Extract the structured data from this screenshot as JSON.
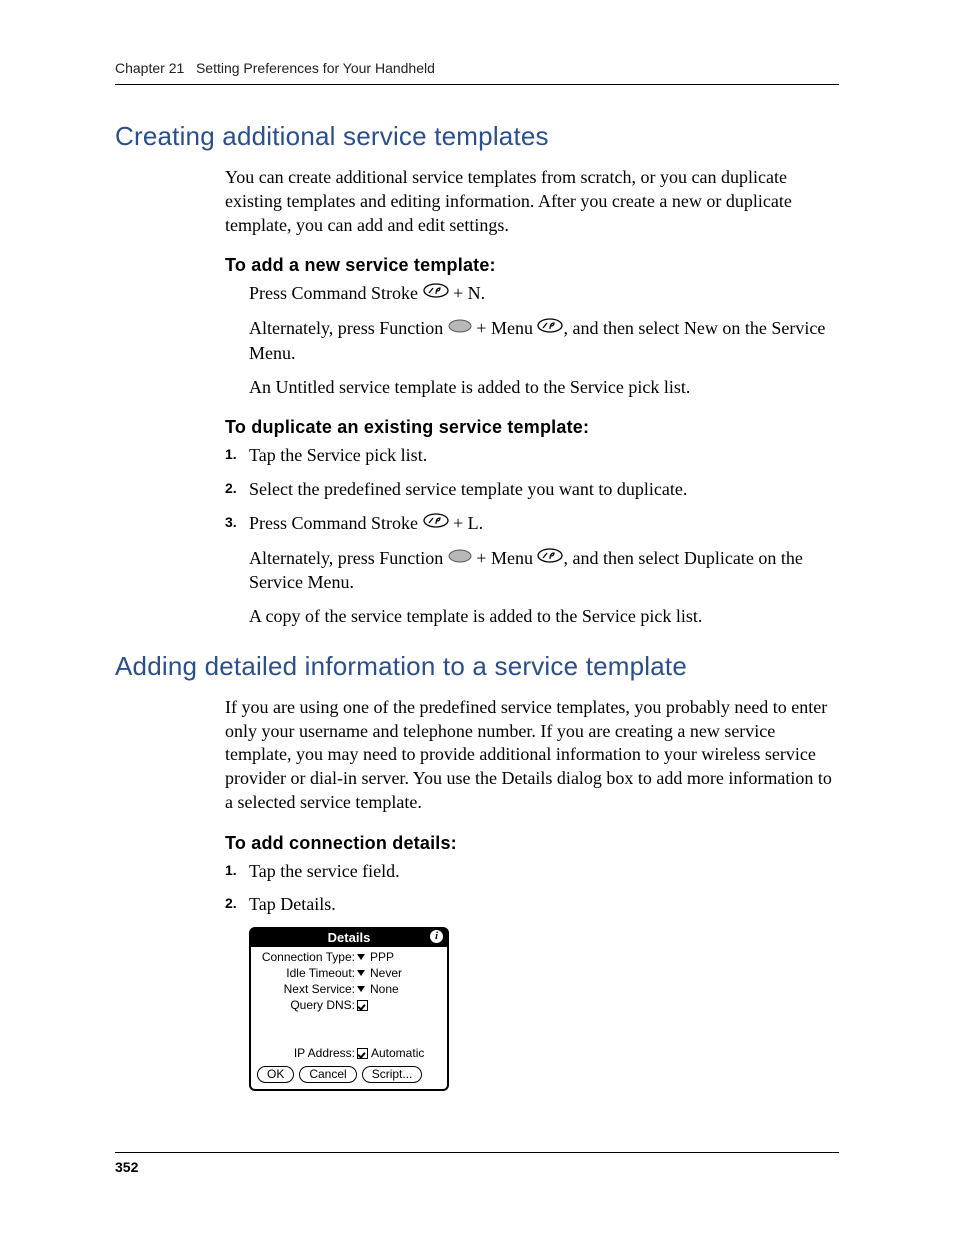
{
  "header": {
    "chapter": "Chapter 21",
    "title": "Setting Preferences for Your Handheld"
  },
  "section1": {
    "heading": "Creating additional service templates",
    "intro": "You can create additional service templates from scratch, or you can duplicate existing templates and editing information. After you create a new or duplicate template, you can add and edit settings.",
    "sub1": {
      "heading": "To add a new service template:",
      "l1a": "Press Command Stroke ",
      "l1b": " + N.",
      "l2a": "Alternately, press Function ",
      "l2b": " + Menu ",
      "l2c": ", and then select New on the Service Menu.",
      "l3": "An Untitled service template is added to the Service pick list."
    },
    "sub2": {
      "heading": "To duplicate an existing service template:",
      "s1": "Tap the Service pick list.",
      "s2": "Select the predefined service template you want to duplicate.",
      "s3a": "Press Command Stroke ",
      "s3b": " + L.",
      "alt_a": "Alternately, press Function ",
      "alt_b": " + Menu ",
      "alt_c": ", and then select Duplicate on the Service Menu.",
      "result": "A copy of the service template is added to the Service pick list."
    }
  },
  "section2": {
    "heading": "Adding detailed information to a service template",
    "intro": "If you are using one of the predefined service templates, you probably need to enter only your username and telephone number. If you are creating a new service template, you may need to provide additional information to your wireless service provider or dial-in server. You use the Details dialog box to add more information to a selected service template.",
    "sub": {
      "heading": "To add connection details:",
      "s1": "Tap the service field.",
      "s2": "Tap Details."
    }
  },
  "dialog": {
    "title": "Details",
    "rows": {
      "conn_label": "Connection Type:",
      "conn_val": "PPP",
      "idle_label": "Idle Timeout:",
      "idle_val": "Never",
      "next_label": "Next Service:",
      "next_val": "None",
      "dns_label": "Query DNS:",
      "ip_label": "IP Address:",
      "ip_val": "Automatic"
    },
    "buttons": {
      "ok": "OK",
      "cancel": "Cancel",
      "script": "Script..."
    }
  },
  "page_number": "352"
}
